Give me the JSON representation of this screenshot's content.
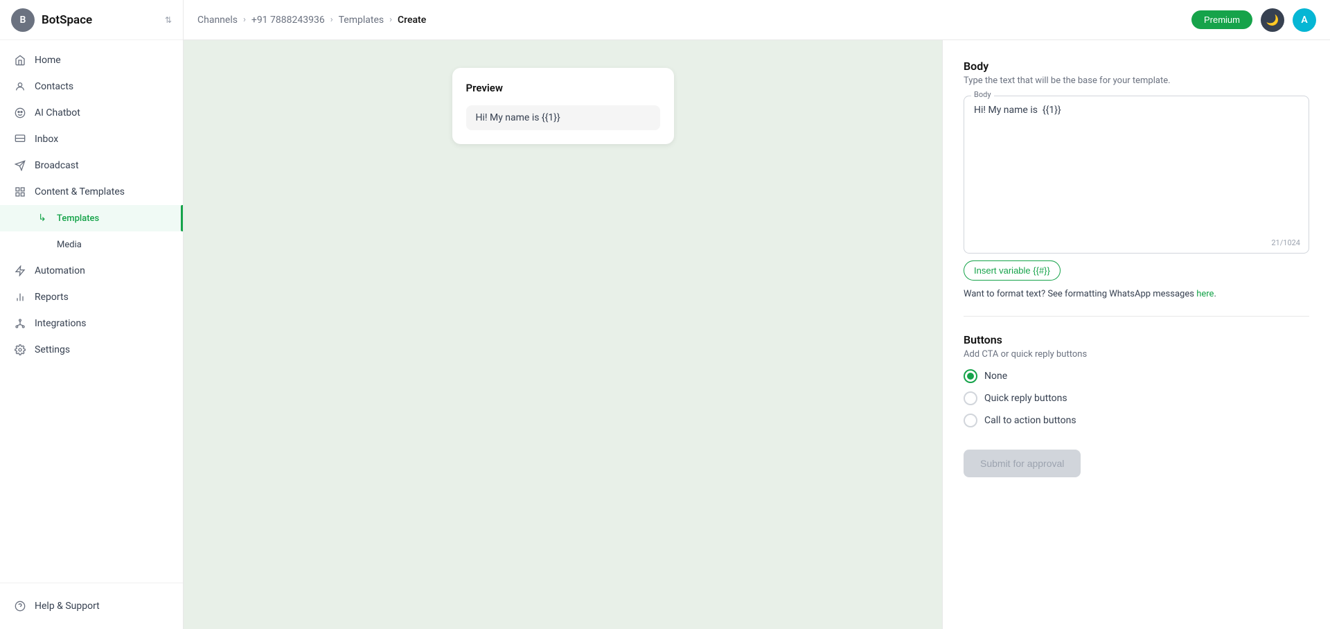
{
  "sidebar": {
    "brand": "BotSpace",
    "logo_letter": "B",
    "items": [
      {
        "id": "home",
        "label": "Home",
        "icon": "🏠",
        "active": false
      },
      {
        "id": "contacts",
        "label": "Contacts",
        "icon": "👤",
        "active": false
      },
      {
        "id": "ai-chatbot",
        "label": "AI Chatbot",
        "icon": "🤖",
        "active": false
      },
      {
        "id": "inbox",
        "label": "Inbox",
        "icon": "📥",
        "active": false
      },
      {
        "id": "broadcast",
        "label": "Broadcast",
        "icon": "📡",
        "active": false
      },
      {
        "id": "content-templates",
        "label": "Content & Templates",
        "icon": "📋",
        "active": false
      },
      {
        "id": "templates",
        "label": "Templates",
        "icon": "↳",
        "active": true,
        "sub": true
      },
      {
        "id": "media",
        "label": "Media",
        "icon": "",
        "active": false,
        "sub": true
      },
      {
        "id": "automation",
        "label": "Automation",
        "icon": "⚡",
        "active": false
      },
      {
        "id": "reports",
        "label": "Reports",
        "icon": "📊",
        "active": false
      },
      {
        "id": "integrations",
        "label": "Integrations",
        "icon": "🔗",
        "active": false
      },
      {
        "id": "settings",
        "label": "Settings",
        "icon": "⚙️",
        "active": false
      }
    ],
    "footer_item": {
      "label": "Help & Support",
      "icon": "❓"
    }
  },
  "topbar": {
    "breadcrumbs": [
      {
        "label": "Channels",
        "active": false
      },
      {
        "label": "+91 7888243936",
        "active": false
      },
      {
        "label": "Templates",
        "active": false
      },
      {
        "label": "Create",
        "active": true
      }
    ],
    "premium_label": "Premium",
    "avatar_letter": "A"
  },
  "preview": {
    "title": "Preview",
    "message": "Hi! My name is  {{1}}"
  },
  "body_section": {
    "title": "Body",
    "description": "Type the text that will be the base for your template.",
    "label": "Body",
    "value": "Hi! My name is  {{1}}",
    "char_count": "21/1024",
    "insert_variable_btn": "Insert variable {{#}}",
    "format_text": "Want to format text? See formatting WhatsApp messages",
    "format_link": "here",
    "format_link_end": "."
  },
  "buttons_section": {
    "title": "Buttons",
    "description": "Add CTA or quick reply buttons",
    "options": [
      {
        "id": "none",
        "label": "None",
        "checked": true
      },
      {
        "id": "quick-reply",
        "label": "Quick reply buttons",
        "checked": false
      },
      {
        "id": "call-to-action",
        "label": "Call to action buttons",
        "checked": false
      }
    ],
    "submit_label": "Submit for approval"
  }
}
